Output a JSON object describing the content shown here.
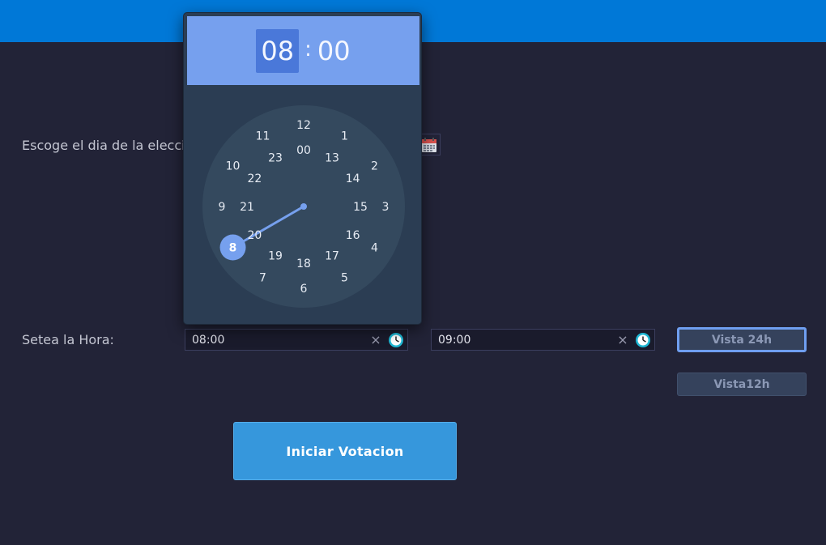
{
  "form": {
    "date_label": "Escoge el dia de la eleccio",
    "time_label": "Setea la Hora:",
    "start_time": "08:00",
    "end_time": "09:00",
    "clear_glyph": "×",
    "view24_label": "Vista 24h",
    "view12_label": "Vista12h",
    "start_button": "Iniciar Votacion"
  },
  "picker": {
    "hour": "08",
    "separator": ":",
    "minute": "00",
    "selected_hour": 8,
    "outer_ring": [
      "12",
      "1",
      "2",
      "3",
      "4",
      "5",
      "6",
      "7",
      "8",
      "9",
      "10",
      "11"
    ],
    "inner_ring": [
      "00",
      "13",
      "14",
      "15",
      "16",
      "17",
      "18",
      "19",
      "20",
      "21",
      "22",
      "23"
    ]
  },
  "icons": {
    "calendar": "calendar-icon",
    "clock": "clock-icon",
    "clear": "clear-icon"
  },
  "colors": {
    "topbar": "#0078d7",
    "background": "#222337",
    "picker_header": "#76a0ee",
    "accent": "#6f9ef0",
    "start_button": "#3697dc"
  }
}
